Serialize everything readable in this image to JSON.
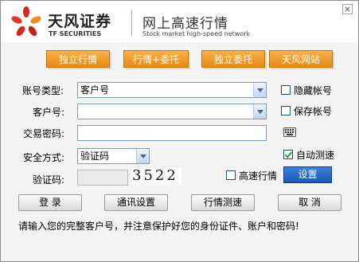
{
  "window": {
    "close_glyph": "×"
  },
  "header": {
    "brand_cn": "天风证券",
    "brand_en": "TF SECURITIES",
    "slogan_cn": "网上高速行情",
    "slogan_en": "Stock market high-speed network",
    "logo_icon": "tf-logo-icon",
    "logo_colors": [
      "#d42a1e",
      "#f08c1c"
    ]
  },
  "nav": {
    "buttons": [
      "独立行情",
      "行情+委托",
      "独立委托",
      "天风网站"
    ],
    "accent": "#e88a0e"
  },
  "form": {
    "account_type_label": "账号类型:",
    "account_type_value": "客户号",
    "account_label": "客户号:",
    "account_value": "",
    "password_label": "交易密码:",
    "password_value": "",
    "keyboard_icon": "keyboard-icon",
    "security_label": "安全方式:",
    "security_value": "验证码",
    "captcha_label": "验证码:",
    "captcha_value": "",
    "captcha_code": "3522",
    "hide_account_label": "隐藏帐号",
    "hide_account_checked": false,
    "save_account_label": "保存帐号",
    "save_account_checked": false,
    "auto_test_label": "自动测速",
    "auto_test_checked": true,
    "fast_quote_label": "高速行情",
    "fast_quote_checked": false,
    "settings_label": "设置"
  },
  "actions": {
    "login": "登  录",
    "comm_settings": "通讯设置",
    "speed_test": "行情测速",
    "cancel": "取  消"
  },
  "footer": {
    "notice": "请输入您的完整客户号，并注意保护好您的身份证件、账户和密码!"
  }
}
